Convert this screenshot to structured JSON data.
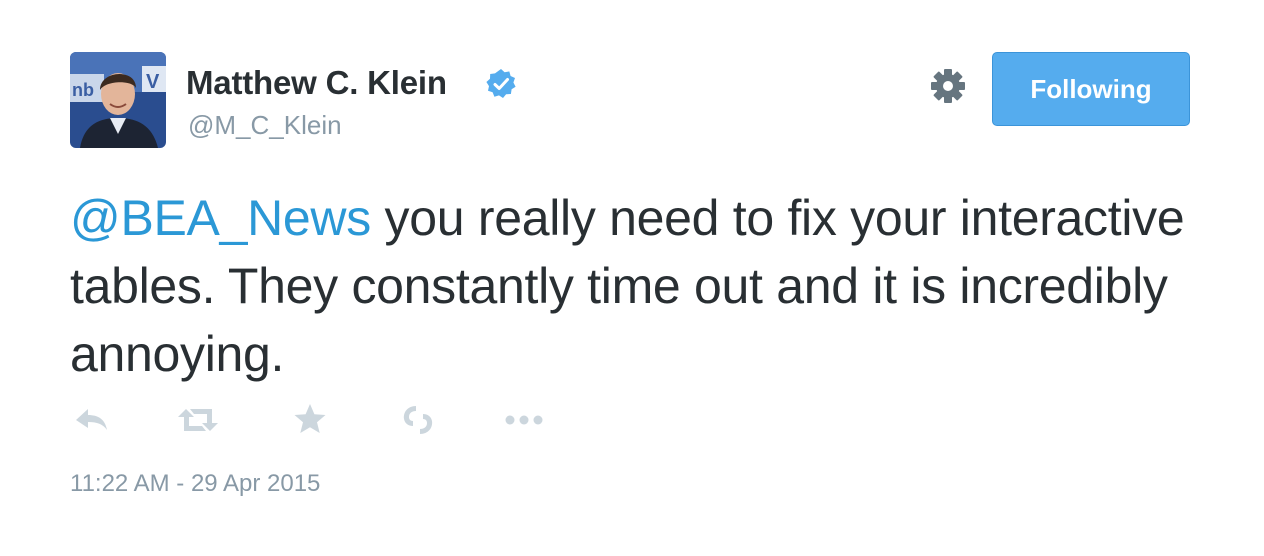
{
  "author": {
    "name": "Matthew C. Klein",
    "handle": "@M_C_Klein",
    "verified": true
  },
  "follow_button": {
    "label": "Following"
  },
  "tweet": {
    "mention": "@BEA_News",
    "text": " you really need to fix your interactive tables. They constantly time out and it is incredibly annoying.",
    "timestamp": "11:22 AM - 29 Apr 2015"
  },
  "actions": [
    {
      "icon": "reply-icon"
    },
    {
      "icon": "retweet-icon"
    },
    {
      "icon": "favorite-star-icon"
    },
    {
      "icon": "tweetdeck-icon"
    },
    {
      "icon": "more-dots-icon"
    }
  ],
  "colors": {
    "link": "#2b98d6",
    "button": "#55acee",
    "muted": "#8899a6",
    "text": "#292f33",
    "icon": "#ccd6dd"
  }
}
